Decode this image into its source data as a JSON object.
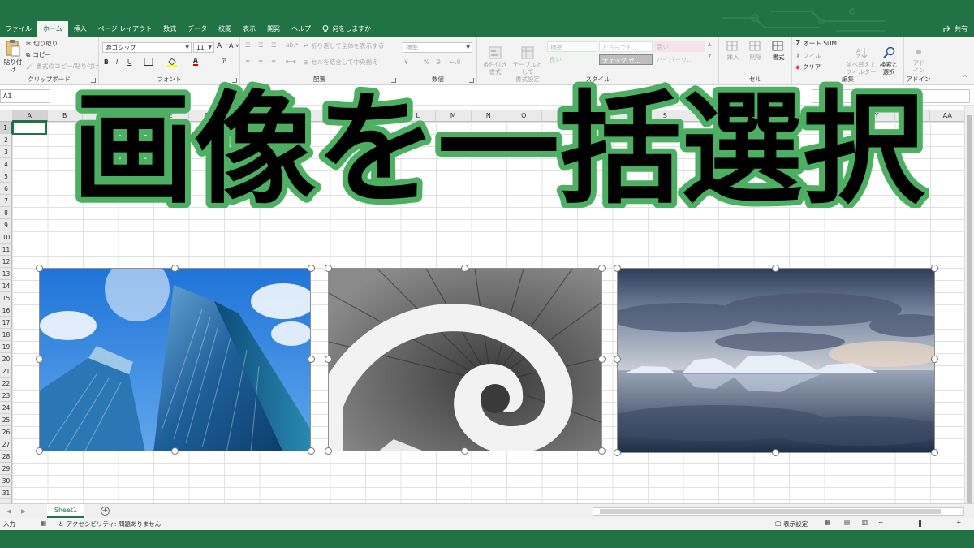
{
  "tabs": [
    "ファイル",
    "ホーム",
    "挿入",
    "ページ レイアウト",
    "数式",
    "データ",
    "校閲",
    "表示",
    "開発",
    "ヘルプ"
  ],
  "tell_me": "何をしますか",
  "share": "共有",
  "ribbon": {
    "clipboard": {
      "paste": "貼り付け",
      "cut": "切り取り",
      "copy": "コピー",
      "format_painter": "書式のコピー/貼り付け",
      "label": "クリップボード"
    },
    "font": {
      "name": "游ゴシック",
      "size": "11",
      "label": "フォント",
      "bold": "B",
      "italic": "I",
      "underline": "U"
    },
    "alignment": {
      "wrap": "折り返して全体を表示する",
      "merge": "セルを結合して中央揃え",
      "label": "配置"
    },
    "number": {
      "format": "標準",
      "percent": "%",
      "comma": "9",
      "label": "数値"
    },
    "styles": {
      "conditional": "条件付き\n書式",
      "table": "テーブルとして\n書式設定",
      "cells": [
        "標準",
        "どちらでも...",
        "悪い",
        "良い",
        "チェック セ...",
        "ハイパーリ..."
      ],
      "label": "スタイル"
    },
    "cells": {
      "insert": "挿入",
      "delete": "削除",
      "format": "書式",
      "label": "セル"
    },
    "editing": {
      "autosum": "オート SUM",
      "fill": "フィル",
      "clear": "クリア",
      "sort": "並べ替えと\nフィルター",
      "find": "検索と\n選択",
      "label": "編集"
    },
    "addins": {
      "addin": "アド\nイン",
      "label": "アドイン"
    }
  },
  "name_box": "A1",
  "columns": [
    "A",
    "B",
    "C",
    "D",
    "E",
    "F",
    "G",
    "H",
    "I",
    "J",
    "K",
    "L",
    "M",
    "N",
    "O",
    "P",
    "Q",
    "R",
    "S",
    "T",
    "U",
    "V",
    "W",
    "X",
    "Y",
    "Z",
    "AA"
  ],
  "rows": [
    "1",
    "2",
    "3",
    "4",
    "5",
    "6",
    "7",
    "8",
    "9",
    "10",
    "11",
    "12",
    "13",
    "14",
    "15",
    "16",
    "17",
    "18",
    "19",
    "20",
    "21",
    "22",
    "23",
    "24",
    "25",
    "26",
    "27",
    "28",
    "29",
    "30",
    "31"
  ],
  "title_text": "画像を一括選択",
  "sheet_tab": "Sheet1",
  "status": {
    "mode": "入力",
    "accessibility": "アクセシビリティ: 問題ありません",
    "display_settings": "表示設定"
  },
  "colors": {
    "excel_green": "#217346",
    "title_fill": "#000000",
    "title_outline": "#4caf62"
  }
}
